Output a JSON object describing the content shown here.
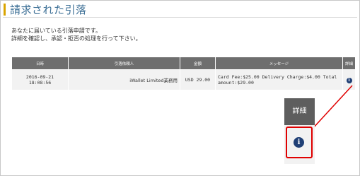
{
  "page": {
    "title": "請求された引落",
    "intro_line1": "あなたに届いている引落申請です。",
    "intro_line2": "詳細を確認し、承認・拒否の処理を行って下さい。"
  },
  "table": {
    "headers": {
      "date": "日時",
      "payee": "引落依頼人",
      "amount": "金額",
      "message": "メッセージ",
      "detail": "詳細"
    },
    "rows": [
      {
        "date_line1": "2016-09-21",
        "date_line2": "18:08:56",
        "payee": "iWallet Limited業務用",
        "amount": "USD 29.00",
        "message_line1": "Card Fee:$25.00 Delivery Charge:$4.00 Total",
        "message_line2": "amount:$29.00",
        "detail_icon": "info-circle-icon"
      }
    ]
  },
  "callout": {
    "header_label": "詳細",
    "icon": "info-circle-icon",
    "highlight_color": "#e00000"
  },
  "colors": {
    "title_accent": "#d9a400",
    "title_text": "#3c6f96",
    "table_header_bg": "#6e6e6e",
    "info_icon": "#1f3f75"
  }
}
